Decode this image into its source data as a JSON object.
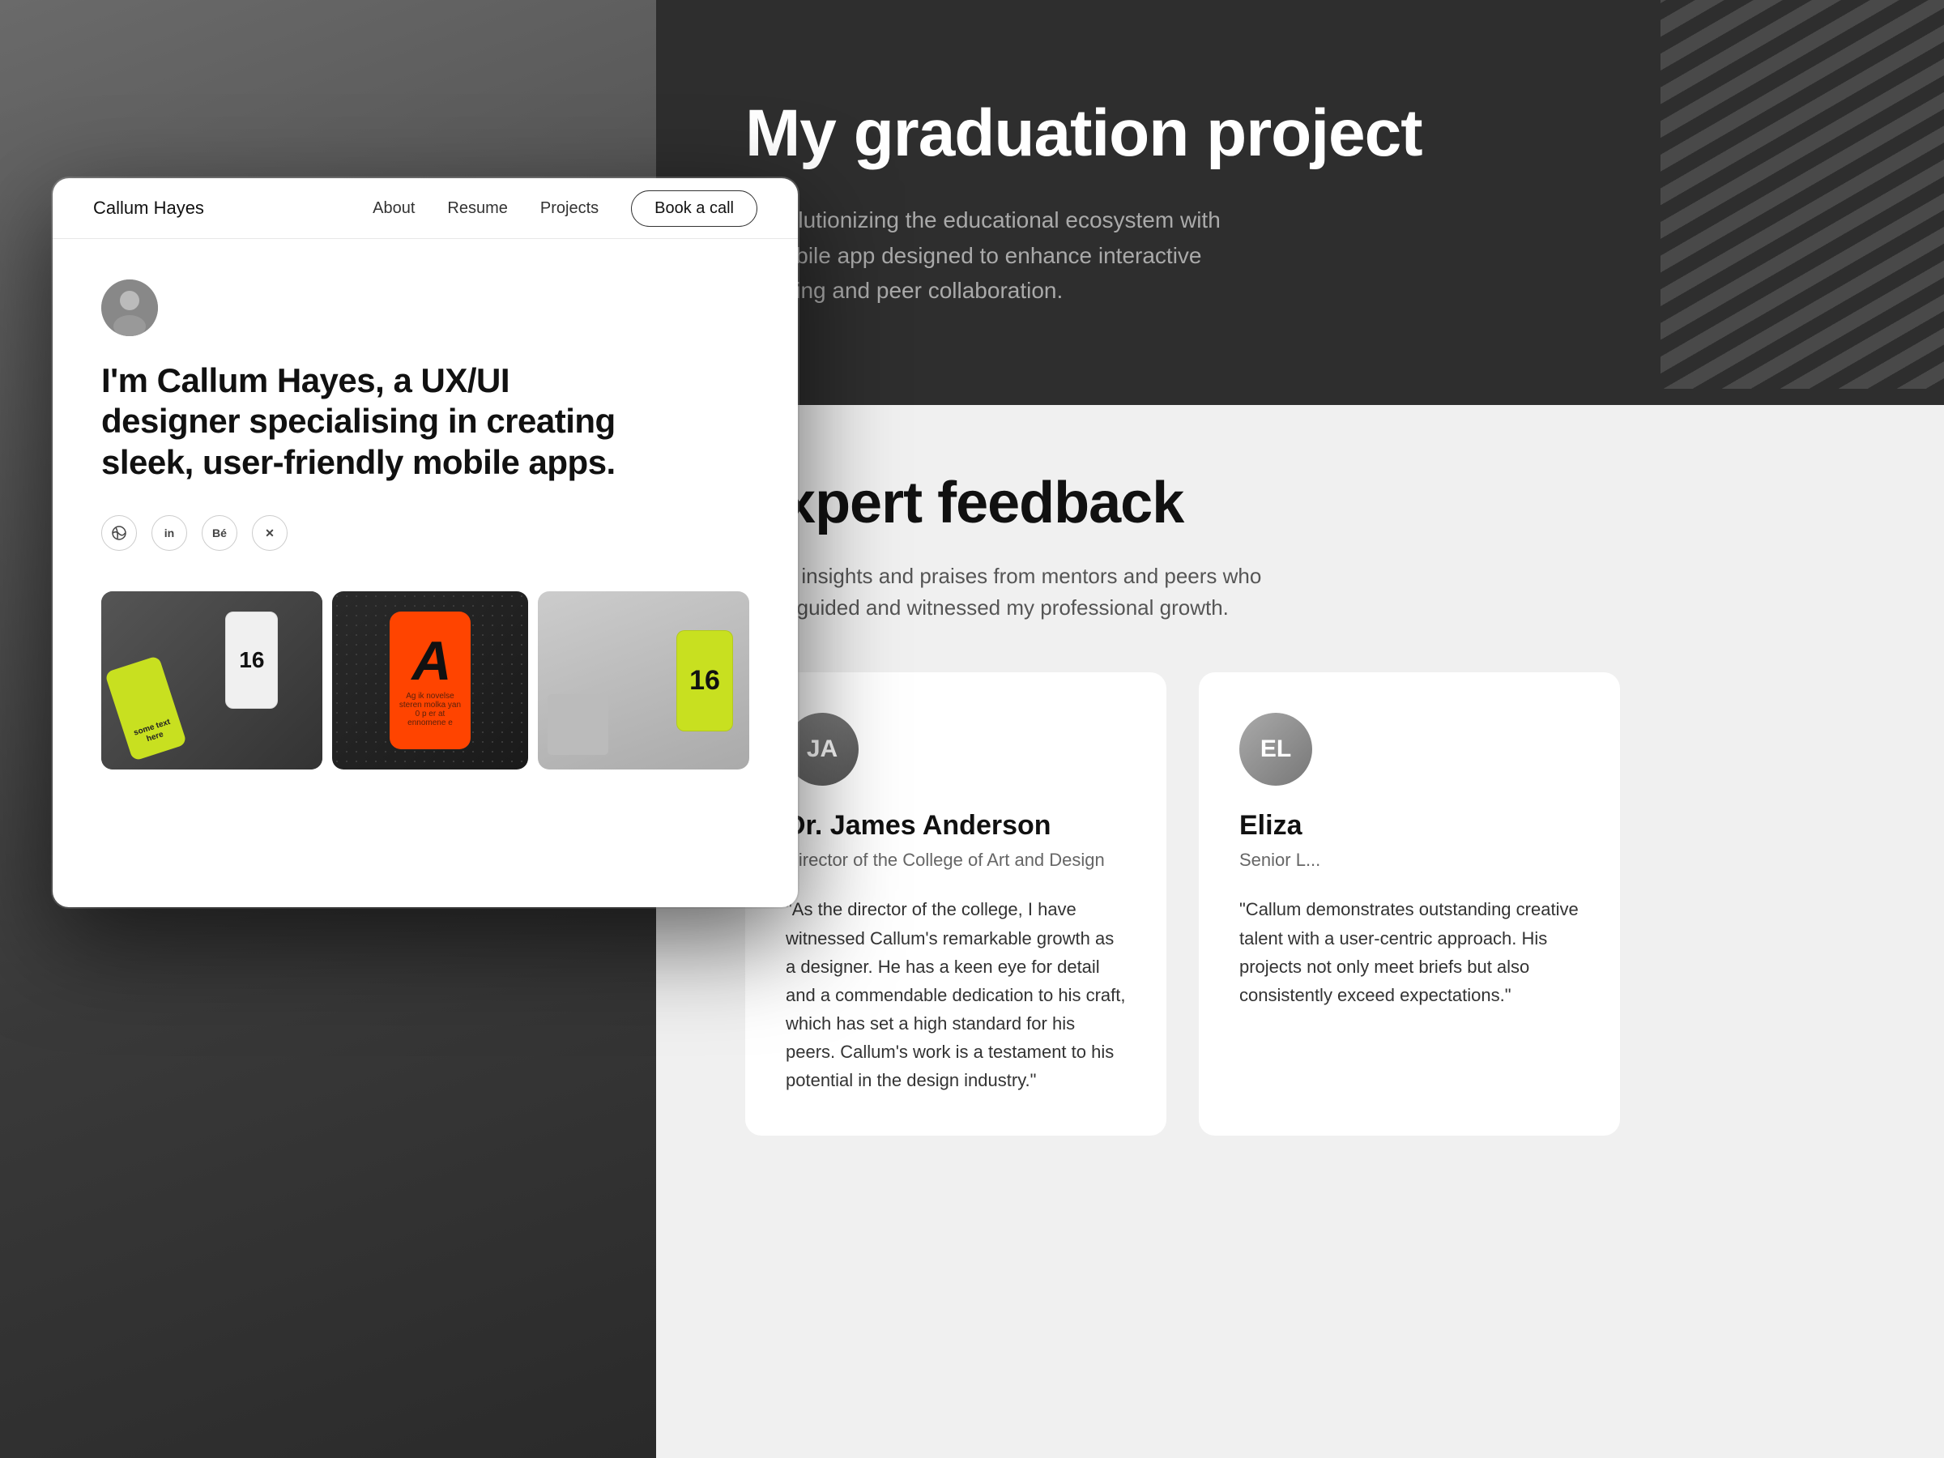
{
  "page": {
    "background": "#4a4a4a"
  },
  "nav": {
    "logo": "Callum Hayes",
    "links": [
      "About",
      "Resume",
      "Projects"
    ],
    "book_call_label": "Book a call"
  },
  "hero": {
    "title": "I'm Callum Hayes, a UX/UI designer specialising in creating sleek, user-friendly mobile apps.",
    "social_icons": [
      {
        "name": "dribbble-icon",
        "symbol": "⊕"
      },
      {
        "name": "linkedin-icon",
        "symbol": "in"
      },
      {
        "name": "behance-icon",
        "symbol": "Bé"
      },
      {
        "name": "twitter-icon",
        "symbol": "𝕏"
      }
    ]
  },
  "right_panel": {
    "top": {
      "title": "My graduation project",
      "description": "Revolutionizing the educational ecosystem with a mobile app designed to enhance interactive learning and peer collaboration."
    },
    "bottom": {
      "section_title": "Expert feedback",
      "section_desc": "Read insights and praises from mentors and peers who have guided and witnessed my professional growth.",
      "testimonials": [
        {
          "name": "Dr. James Anderson",
          "role": "Director of the College of Art and Design",
          "text": "\"As the director of the college, I have witnessed Callum's remarkable growth as a designer. He has a keen eye for detail and a commendable dedication to his craft, which has set a high standard for his peers. Callum's work is a testament to his potential in the design industry.\""
        },
        {
          "name": "Eliza",
          "role": "Senior L...",
          "text": "\"Callum... creative... centric... project... but also... exceed...\""
        }
      ]
    }
  }
}
